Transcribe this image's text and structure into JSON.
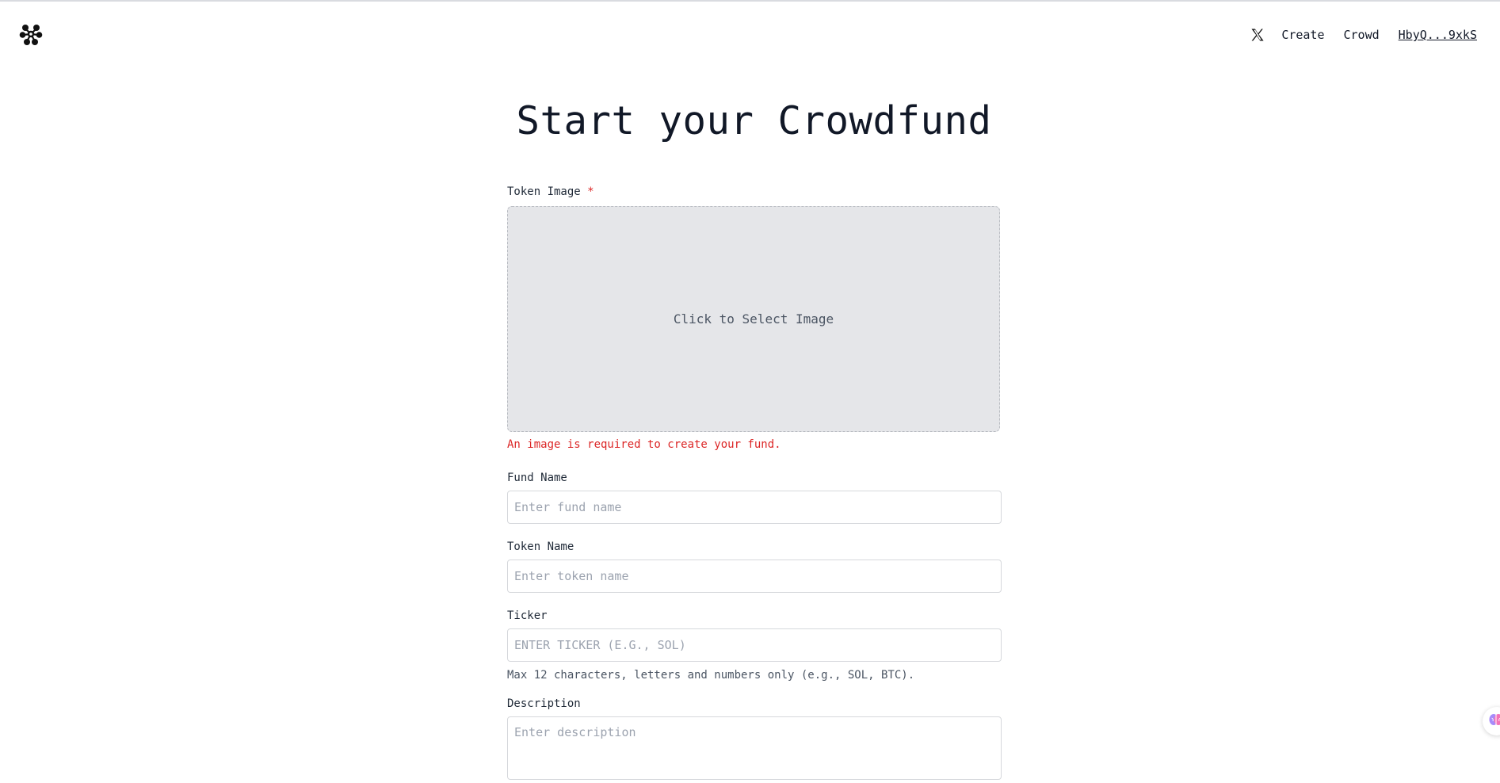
{
  "header": {
    "logo_icon": "molecule-logo-icon",
    "nav": {
      "x_icon": "x-twitter-icon",
      "create_label": "Create",
      "crowd_label": "Crowd",
      "wallet_label": "HbyQ...9xkS"
    }
  },
  "page": {
    "title": "Start your Crowdfund"
  },
  "form": {
    "token_image": {
      "label": "Token Image",
      "required_mark": "*",
      "dropzone_text": "Click to Select Image",
      "error": "An image is required to create your fund."
    },
    "fund_name": {
      "label": "Fund Name",
      "placeholder": "Enter fund name",
      "value": ""
    },
    "token_name": {
      "label": "Token Name",
      "placeholder": "Enter token name",
      "value": ""
    },
    "ticker": {
      "label": "Ticker",
      "placeholder": "ENTER TICKER (E.G., SOL)",
      "value": "",
      "hint": "Max 12 characters, letters and numbers only (e.g., SOL, BTC)."
    },
    "description": {
      "label": "Description",
      "placeholder": "Enter description",
      "value": ""
    }
  },
  "floating_widget": {
    "icon": "brain-icon"
  },
  "colors": {
    "text": "#111827",
    "error": "#dc2626",
    "dropzone_bg": "#e5e6e9",
    "border": "#d6d8dc"
  }
}
